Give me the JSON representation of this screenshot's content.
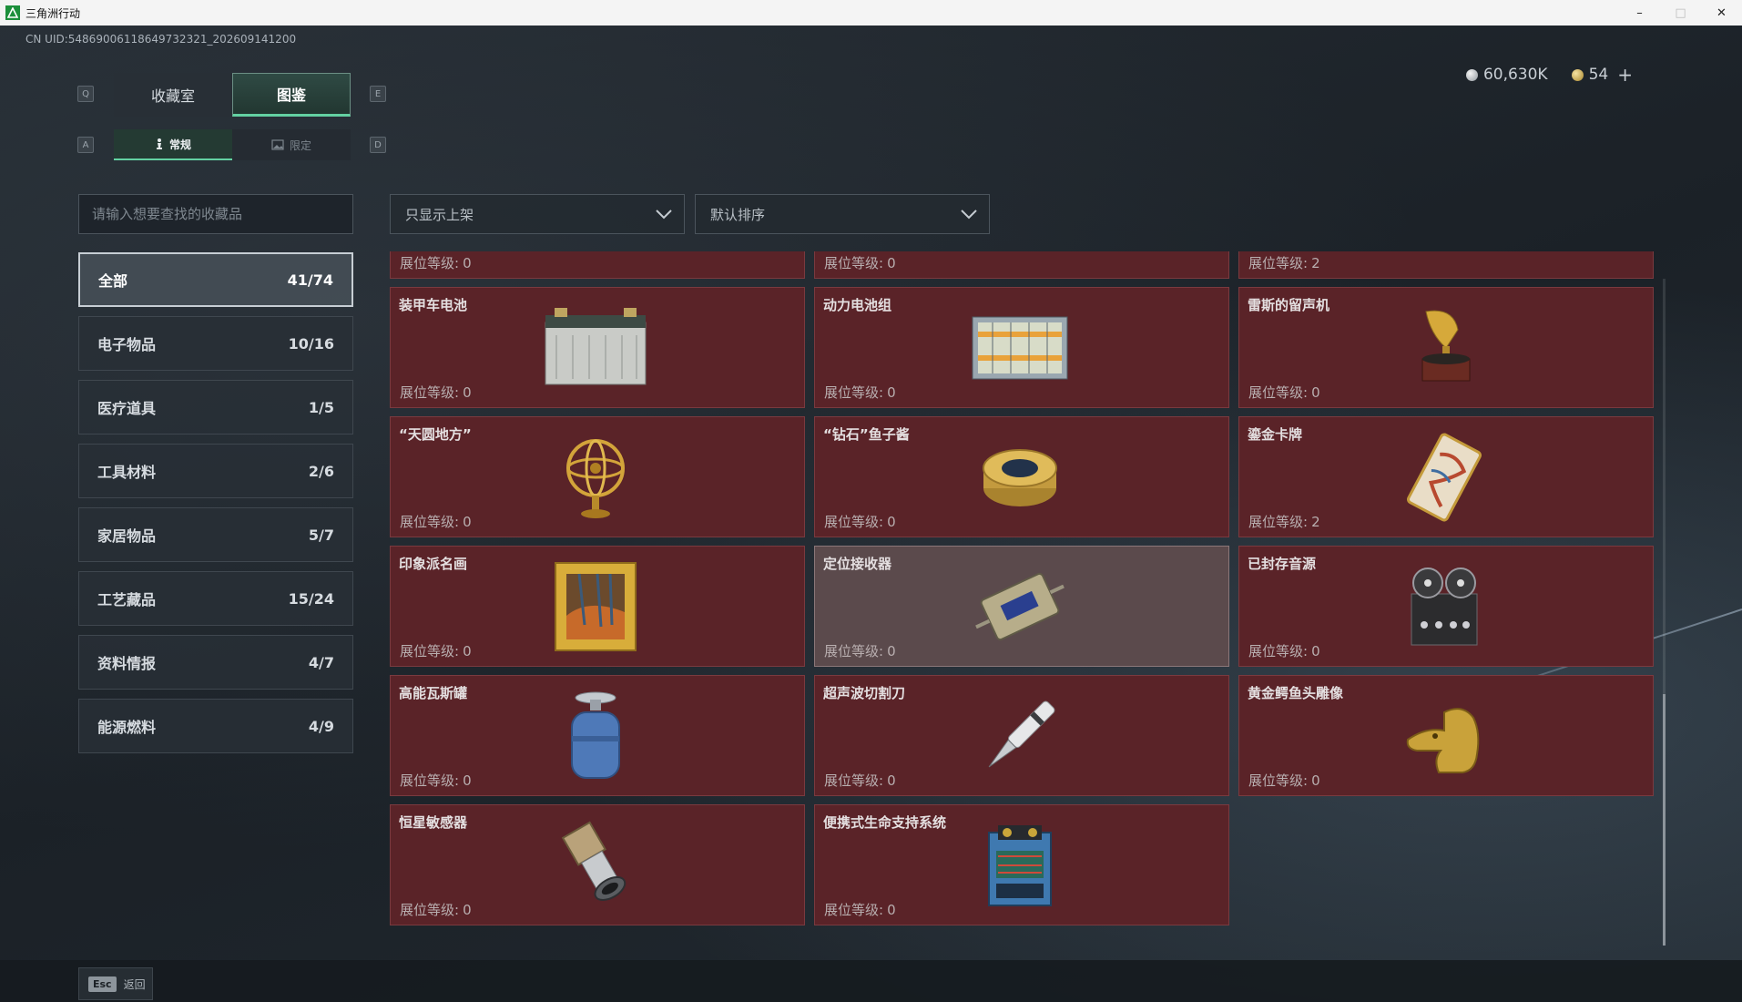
{
  "window": {
    "title": "三角洲行动",
    "minimize": "–",
    "maximize": "□",
    "close": "✕"
  },
  "uid": "CN UID:548690061186497323​21_202609141200",
  "currency": {
    "coins": "60,630K",
    "premium": "54",
    "plus": "+"
  },
  "keys": {
    "q": "Q",
    "e": "E",
    "a": "A",
    "d": "D"
  },
  "tabs": {
    "main": [
      "收藏室",
      "图鉴"
    ],
    "sub": [
      "常规",
      "限定"
    ]
  },
  "search": {
    "placeholder": "请输入想要查找的收藏品"
  },
  "filters": {
    "display": "只显示上架",
    "sort": "默认排序"
  },
  "categories": [
    {
      "label": "全部",
      "count": "41/74"
    },
    {
      "label": "电子物品",
      "count": "10/16"
    },
    {
      "label": "医疗道具",
      "count": "1/5"
    },
    {
      "label": "工具材料",
      "count": "2/6"
    },
    {
      "label": "家居物品",
      "count": "5/7"
    },
    {
      "label": "工艺藏品",
      "count": "15/24"
    },
    {
      "label": "资料情报",
      "count": "4/7"
    },
    {
      "label": "能源燃料",
      "count": "4/9"
    }
  ],
  "level_label": "展位等级:",
  "items": [
    {
      "name": "",
      "level": "0",
      "icon": "partial-item-icon"
    },
    {
      "name": "",
      "level": "0",
      "icon": "partial-item-icon"
    },
    {
      "name": "",
      "level": "2",
      "icon": "partial-item-icon"
    },
    {
      "name": "装甲车电池",
      "level": "0",
      "icon": "car-battery-icon"
    },
    {
      "name": "动力电池组",
      "level": "0",
      "icon": "battery-pack-icon"
    },
    {
      "name": "雷斯的留声机",
      "level": "0",
      "icon": "gramophone-icon"
    },
    {
      "name": "“天圆地方”",
      "level": "0",
      "icon": "armillary-sphere-icon"
    },
    {
      "name": "“钻石”鱼子酱",
      "level": "0",
      "icon": "caviar-tin-icon"
    },
    {
      "name": "鎏金卡牌",
      "level": "2",
      "icon": "gilded-card-icon"
    },
    {
      "name": "印象派名画",
      "level": "0",
      "icon": "framed-painting-icon"
    },
    {
      "name": "定位接收器",
      "level": "0",
      "icon": "gps-receiver-icon"
    },
    {
      "name": "已封存音源",
      "level": "0",
      "icon": "reel-recorder-icon"
    },
    {
      "name": "高能瓦斯罐",
      "level": "0",
      "icon": "gas-canister-icon"
    },
    {
      "name": "超声波切割刀",
      "level": "0",
      "icon": "ultrasonic-cutter-icon"
    },
    {
      "name": "黄金鳄鱼头雕像",
      "level": "0",
      "icon": "golden-crocodile-icon"
    },
    {
      "name": "恒星敏感器",
      "level": "0",
      "icon": "star-sensor-icon"
    },
    {
      "name": "便携式生命支持系统",
      "level": "0",
      "icon": "life-support-icon"
    }
  ],
  "footer": {
    "esc_key": "Esc",
    "back": "返回"
  },
  "colors": {
    "card_bg": "#5a2328",
    "accent": "#63d1a2",
    "highlight_card": "#5b4a4c"
  }
}
